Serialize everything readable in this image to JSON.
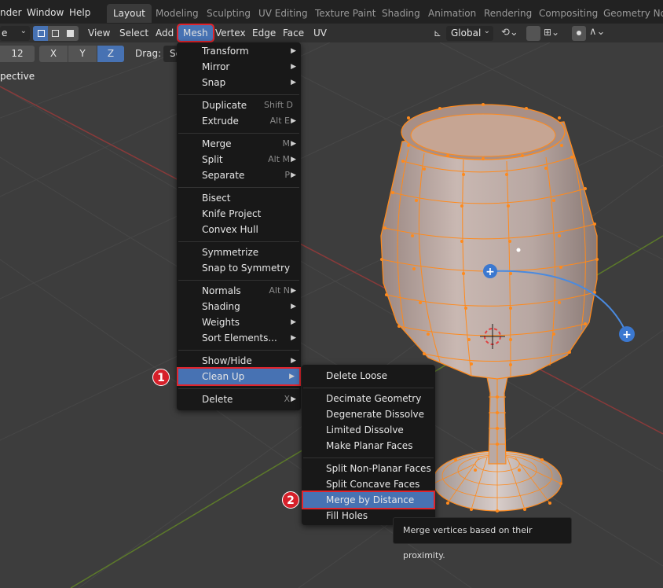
{
  "topbar": {
    "menus": [
      "nder",
      "Window",
      "Help"
    ],
    "workspaces": [
      "Layout",
      "Modeling",
      "Sculpting",
      "UV Editing",
      "Texture Paint",
      "Shading",
      "Animation",
      "Rendering",
      "Compositing",
      "Geometry Node"
    ],
    "active_workspace": "Layout"
  },
  "header": {
    "mode_partial": "e",
    "menus": [
      "View",
      "Select",
      "Add",
      "Mesh",
      "Vertex",
      "Edge",
      "Face",
      "UV"
    ],
    "transform_orientation": "Global"
  },
  "toolrow": {
    "value": "12",
    "axes": [
      "X",
      "Y",
      "Z"
    ],
    "drag_label": "Drag:",
    "drag_value": "Se"
  },
  "viewport": {
    "label": "pective"
  },
  "mesh_menu": {
    "items": [
      {
        "label": "Transform",
        "shortcut": "",
        "submenu": true
      },
      {
        "label": "Mirror",
        "shortcut": "",
        "submenu": true
      },
      {
        "label": "Snap",
        "shortcut": "",
        "submenu": true
      },
      {
        "label": "Duplicate",
        "shortcut": "Shift D",
        "submenu": false
      },
      {
        "label": "Extrude",
        "shortcut": "Alt E",
        "submenu": true
      },
      {
        "label": "Merge",
        "shortcut": "M",
        "submenu": true
      },
      {
        "label": "Split",
        "shortcut": "Alt M",
        "submenu": true
      },
      {
        "label": "Separate",
        "shortcut": "P",
        "submenu": true
      },
      {
        "label": "Bisect",
        "shortcut": "",
        "submenu": false
      },
      {
        "label": "Knife Project",
        "shortcut": "",
        "submenu": false
      },
      {
        "label": "Convex Hull",
        "shortcut": "",
        "submenu": false
      },
      {
        "label": "Symmetrize",
        "shortcut": "",
        "submenu": false
      },
      {
        "label": "Snap to Symmetry",
        "shortcut": "",
        "submenu": false
      },
      {
        "label": "Normals",
        "shortcut": "Alt N",
        "submenu": true
      },
      {
        "label": "Shading",
        "shortcut": "",
        "submenu": true
      },
      {
        "label": "Weights",
        "shortcut": "",
        "submenu": true
      },
      {
        "label": "Sort Elements...",
        "shortcut": "",
        "submenu": true
      },
      {
        "label": "Show/Hide",
        "shortcut": "",
        "submenu": true
      },
      {
        "label": "Clean Up",
        "shortcut": "",
        "submenu": true
      },
      {
        "label": "Delete",
        "shortcut": "X",
        "submenu": true
      }
    ]
  },
  "cleanup_menu": {
    "items": [
      {
        "label": "Delete Loose"
      },
      {
        "label": "Decimate Geometry"
      },
      {
        "label": "Degenerate Dissolve"
      },
      {
        "label": "Limited Dissolve"
      },
      {
        "label": "Make Planar Faces"
      },
      {
        "label": "Split Non-Planar Faces"
      },
      {
        "label": "Split Concave Faces"
      },
      {
        "label": "Merge by Distance"
      },
      {
        "label": "Fill Holes"
      }
    ]
  },
  "badges": [
    "1",
    "2"
  ],
  "tooltip": "Merge vertices based on their proximity.",
  "colors": {
    "accent": "#4772b3",
    "highlight_box": "#e0242c",
    "badge": "#d6202a",
    "menu_bg": "#181818",
    "vertex": "#ff8a1c"
  }
}
